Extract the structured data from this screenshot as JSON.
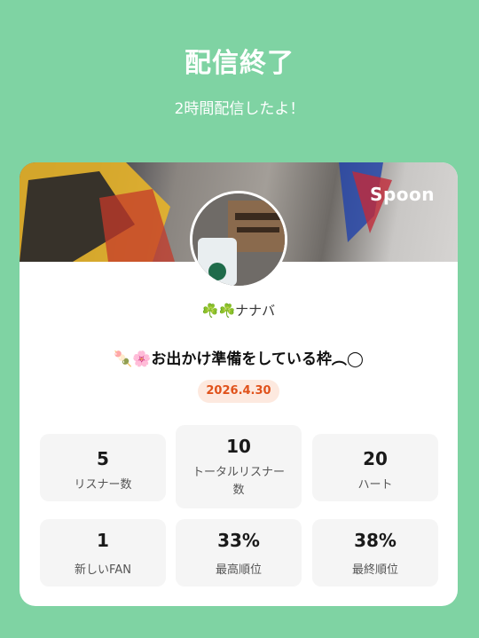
{
  "header": {
    "title": "配信終了",
    "subtitle": "2時間配信したよ！"
  },
  "card": {
    "brand": "Spoon",
    "username": "☘️☘️ナナバ",
    "stream_title": "🍡🌸お出かけ準備をしている枠︵◯",
    "date": "2026.4.30"
  },
  "stats": [
    {
      "value": "5",
      "label": "リスナー数"
    },
    {
      "value": "10",
      "label": "トータルリスナー数"
    },
    {
      "value": "20",
      "label": "ハート"
    },
    {
      "value": "1",
      "label": "新しいFAN"
    },
    {
      "value": "33%",
      "label": "最高順位"
    },
    {
      "value": "38%",
      "label": "最終順位"
    }
  ],
  "colors": {
    "background": "#7fd3a3",
    "card": "#ffffff",
    "date_text": "#e0521b",
    "date_bg": "#fde9df",
    "stat_bg": "#f5f5f5"
  }
}
